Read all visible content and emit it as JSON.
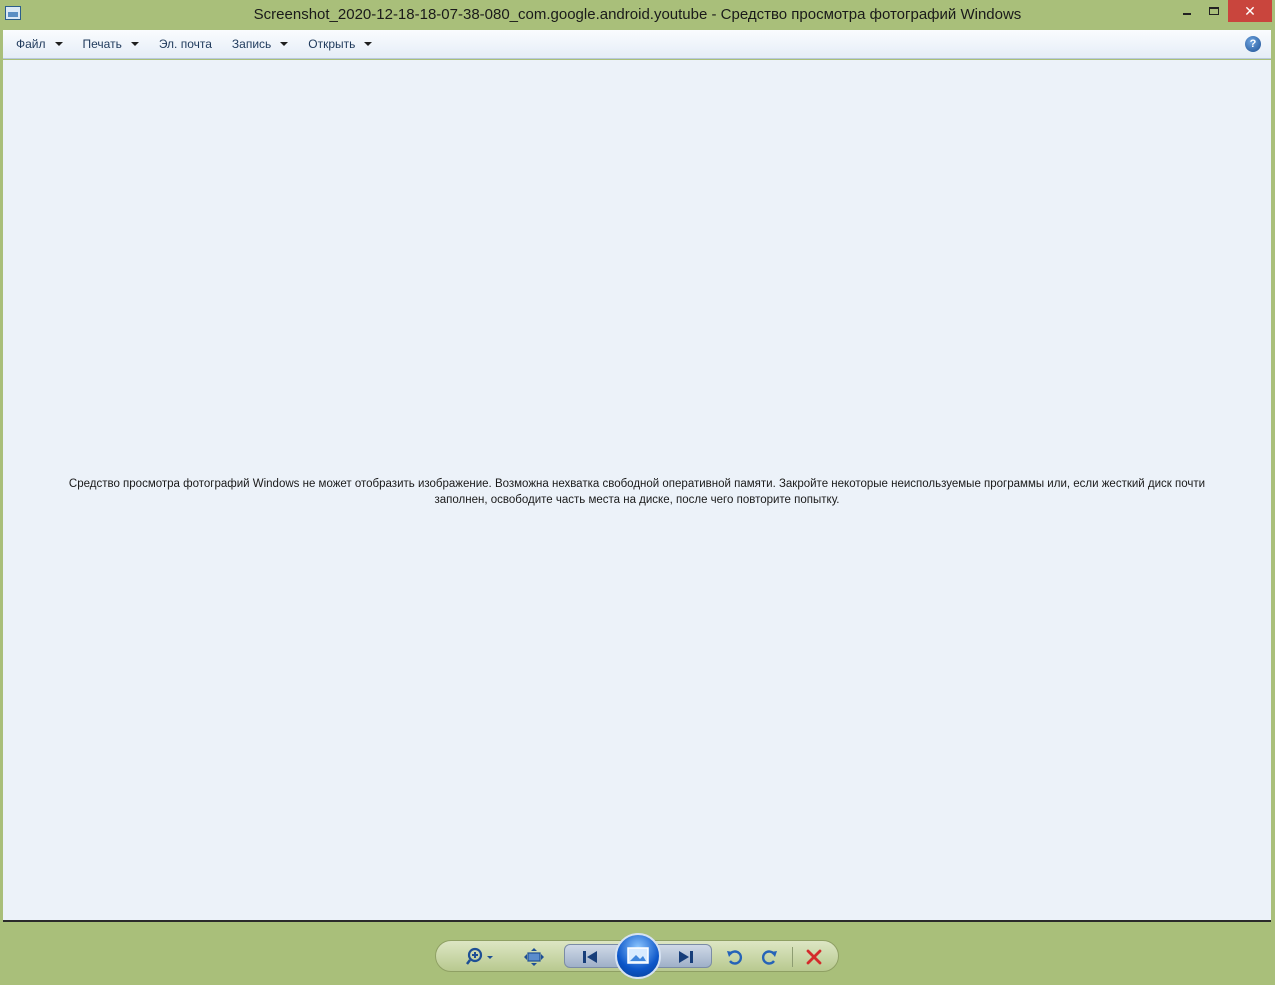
{
  "window": {
    "title": "Screenshot_2020-12-18-18-07-38-080_com.google.android.youtube - Средство просмотра фотографий Windows",
    "controls": {
      "minimize": "minimize-icon",
      "maximize": "maximize-icon",
      "close": "close-icon"
    }
  },
  "menu": {
    "items": [
      {
        "label": "Файл",
        "has_dropdown": true
      },
      {
        "label": "Печать",
        "has_dropdown": true
      },
      {
        "label": "Эл. почта",
        "has_dropdown": false
      },
      {
        "label": "Запись",
        "has_dropdown": true
      },
      {
        "label": "Открыть",
        "has_dropdown": true
      }
    ],
    "help_icon": "help-icon",
    "help_glyph": "?"
  },
  "viewer": {
    "error_message_line1": "Средство просмотра фотографий Windows не может отобразить изображение. Возможна нехватка свободной оперативной памяти. Закройте некоторые неиспользуемые программы или, если жесткий диск почти",
    "error_message_line2": "заполнен, освободите часть места на диске, после чего повторите попытку."
  },
  "toolbar": {
    "buttons": [
      "zoom-icon",
      "actual-size-icon",
      "previous-icon",
      "slideshow-icon",
      "next-icon",
      "rotate-left-icon",
      "rotate-right-icon",
      "delete-icon"
    ]
  },
  "colors": {
    "frame": "#a9bf7a",
    "viewer_bg": "#ecf2f9",
    "close_button": "#c9453d",
    "slideshow": "#0c56c9",
    "delete": "#d42b2b",
    "rotate": "#2563b8"
  }
}
